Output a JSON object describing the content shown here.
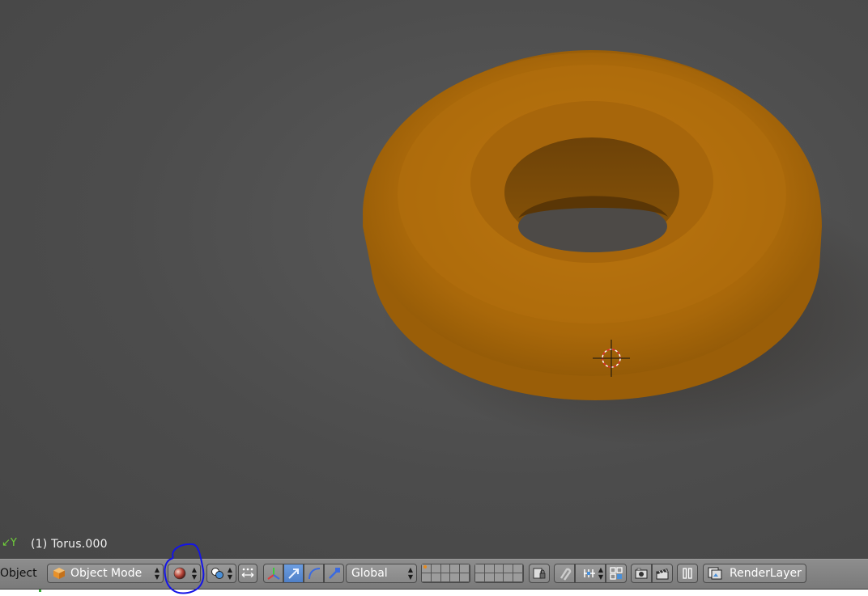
{
  "viewport": {
    "axis_label": "Y",
    "object_info": "(1) Torus.000"
  },
  "header": {
    "menu_object": "Object",
    "mode": "Object Mode",
    "orientation": "Global",
    "render_layer": "RenderLayer"
  },
  "icons": {
    "mode": "object-cube-icon",
    "shading": "viewport-shading-sphere-icon",
    "pivot": "pivot-point-icon",
    "manipulator": "manipulator-axes-icon",
    "translate": "translate-arrow-icon",
    "rotate": "rotate-arc-icon",
    "scale": "scale-arrow-icon",
    "lock_layers": "lock-layers-icon",
    "snap": "magnet-snap-icon",
    "snap_element": "snap-increment-icon",
    "snap_target": "snap-target-icon",
    "render_camera": "render-camera-icon",
    "render_anim": "clapperboard-icon",
    "pause": "pause-icon",
    "render_layer": "render-layer-icon"
  },
  "colors": {
    "torus": "#b8720c",
    "active_button": "#5b8fd8",
    "annotation": "#1414e6",
    "axis_y": "#6fcf3a"
  }
}
